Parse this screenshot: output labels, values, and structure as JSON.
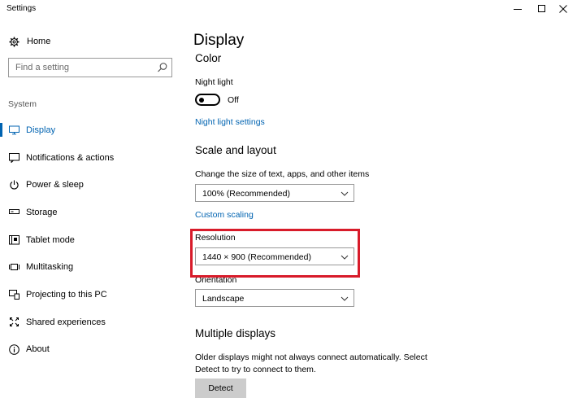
{
  "window": {
    "title": "Settings"
  },
  "sidebar": {
    "home_label": "Home",
    "search_placeholder": "Find a setting",
    "section_label": "System",
    "items": [
      {
        "label": "Display",
        "icon": "monitor-icon",
        "active": true
      },
      {
        "label": "Notifications & actions",
        "icon": "notification-icon"
      },
      {
        "label": "Power & sleep",
        "icon": "power-icon"
      },
      {
        "label": "Storage",
        "icon": "storage-icon"
      },
      {
        "label": "Tablet mode",
        "icon": "tablet-icon"
      },
      {
        "label": "Multitasking",
        "icon": "multitasking-icon"
      },
      {
        "label": "Projecting to this PC",
        "icon": "projecting-icon"
      },
      {
        "label": "Shared experiences",
        "icon": "shared-icon"
      },
      {
        "label": "About",
        "icon": "info-icon"
      }
    ]
  },
  "main": {
    "title": "Display",
    "color_heading": "Color",
    "night_light_label": "Night light",
    "night_light_state": "Off",
    "night_light_settings_link": "Night light settings",
    "scale_heading": "Scale and layout",
    "scale_label": "Change the size of text, apps, and other items",
    "scale_value": "100% (Recommended)",
    "custom_scaling_link": "Custom scaling",
    "resolution_label": "Resolution",
    "resolution_value": "1440 × 900 (Recommended)",
    "orientation_label": "Orientation",
    "orientation_value": "Landscape",
    "multiple_heading": "Multiple displays",
    "multiple_desc": "Older displays might not always connect automatically. Select Detect to try to connect to them.",
    "detect_label": "Detect"
  },
  "colors": {
    "accent": "#0063b1",
    "highlight": "#d81b2a"
  }
}
